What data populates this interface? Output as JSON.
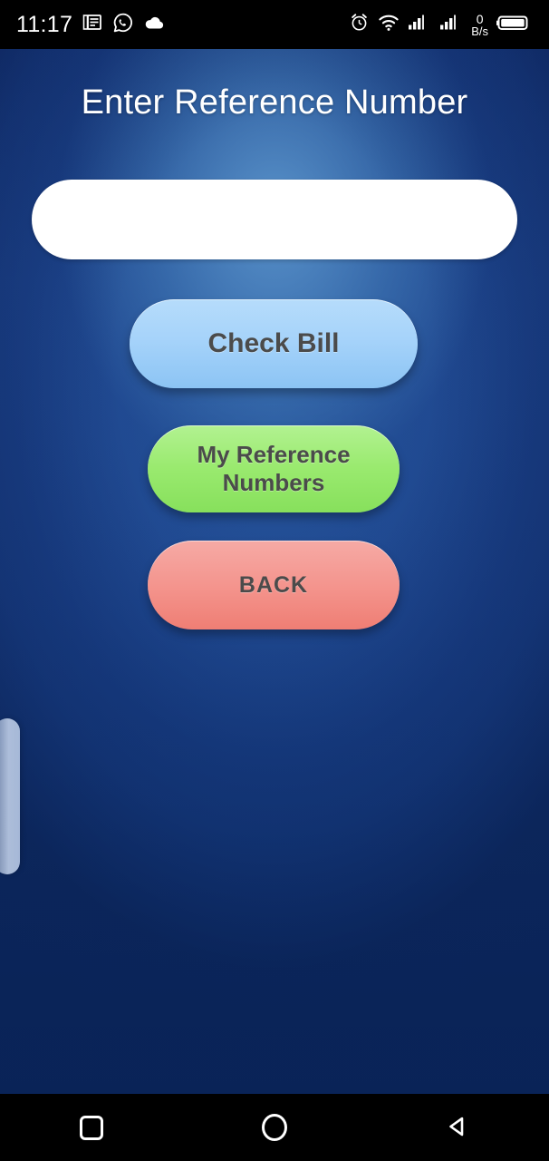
{
  "status_bar": {
    "time": "11:17",
    "left_icons": [
      "news-document-icon",
      "whatsapp-icon",
      "cloud-icon"
    ],
    "right_icons": [
      "alarm-clock-icon",
      "wifi-icon",
      "signal-sim1-icon",
      "signal-sim2-icon",
      "battery-icon"
    ],
    "data_rate_value": "0",
    "data_rate_unit": "B/s"
  },
  "screen": {
    "title": "Enter Reference Number",
    "background_top_color": "#16357a",
    "background_center_color": "#3b76b0",
    "background_bottom_color": "#0f3578"
  },
  "reference_input": {
    "value": "",
    "placeholder": ""
  },
  "buttons": {
    "check_bill": {
      "label": "Check Bill",
      "color": "#a6d3fa"
    },
    "my_reference_numbers": {
      "label": "My Reference Numbers",
      "color": "#9aea6f"
    },
    "back": {
      "label": "BACK",
      "color": "#f4958e"
    }
  },
  "edge_handle": {
    "name": "edge-swipe-handle",
    "color": "#bacae4"
  },
  "nav_bar": {
    "recents_label": "recents-square-icon",
    "home_label": "home-circle-icon",
    "back_label": "back-triangle-icon"
  }
}
